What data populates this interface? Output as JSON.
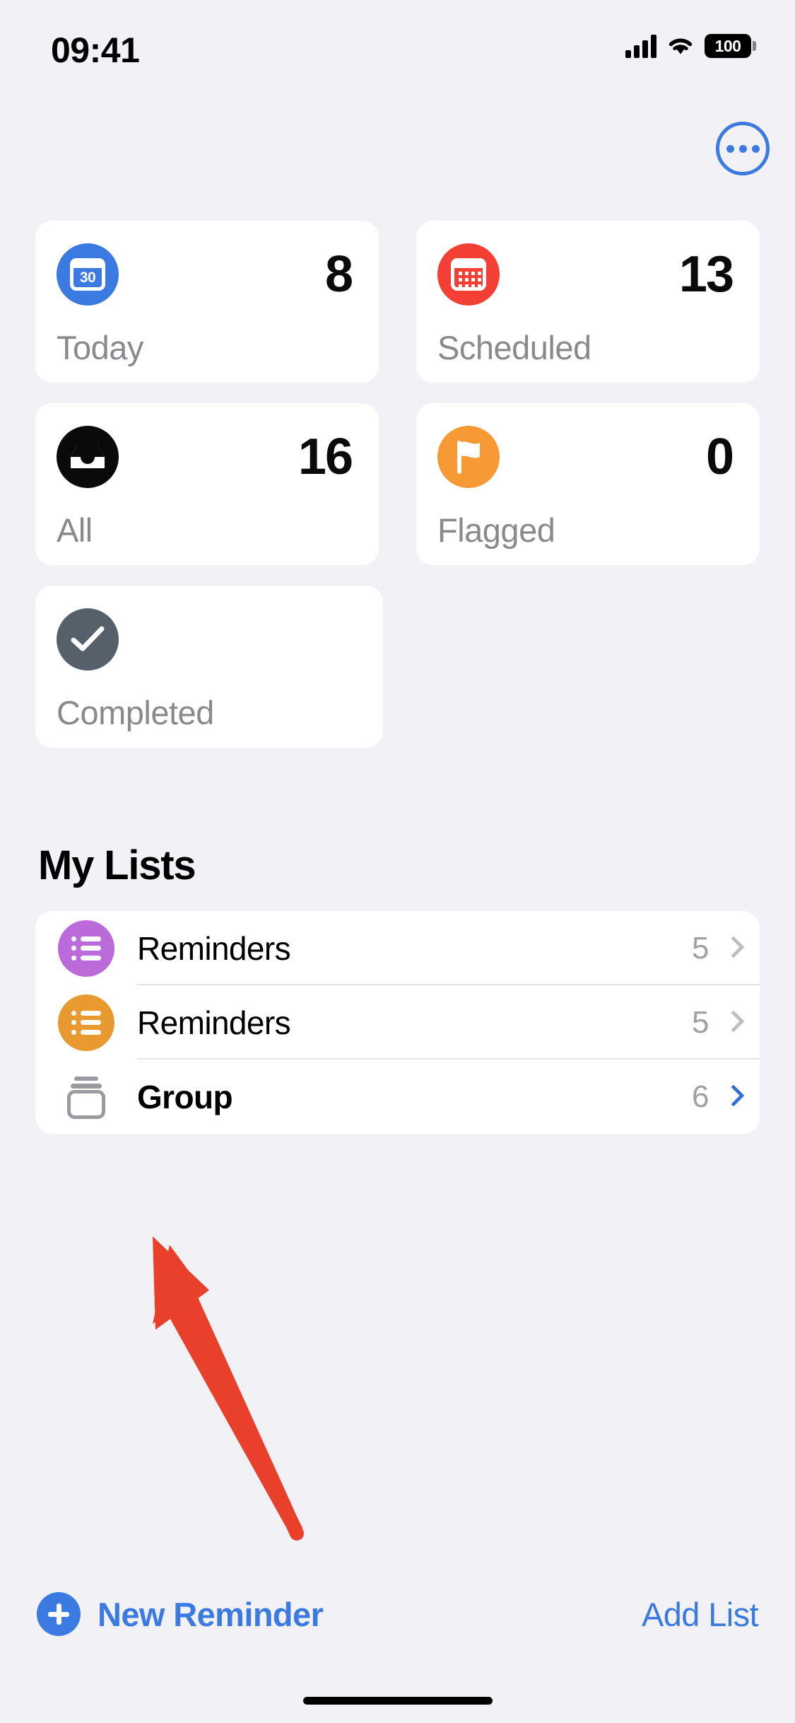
{
  "status_bar": {
    "time": "09:41",
    "cellular_icon": "cellular-bars-icon",
    "wifi_icon": "wifi-icon",
    "battery_level": "100"
  },
  "nav": {
    "more_button_icon": "more-ellipsis-icon",
    "more_button_label": "More"
  },
  "smart_lists": [
    {
      "id": "today",
      "label": "Today",
      "count": "8",
      "icon": "calendar-day-icon",
      "icon_day": "30",
      "color": "#3b7ae0"
    },
    {
      "id": "scheduled",
      "label": "Scheduled",
      "count": "13",
      "icon": "calendar-grid-icon",
      "color": "#f43f34"
    },
    {
      "id": "all",
      "label": "All",
      "count": "16",
      "icon": "inbox-tray-icon",
      "color": "#0a0a0a"
    },
    {
      "id": "flagged",
      "label": "Flagged",
      "count": "0",
      "icon": "flag-icon",
      "color": "#f79a36"
    },
    {
      "id": "completed",
      "label": "Completed",
      "count": "",
      "icon": "checkmark-icon",
      "color": "#56606a"
    }
  ],
  "my_lists": {
    "heading": "My Lists",
    "rows": [
      {
        "name": "Reminders",
        "count": "5",
        "icon": "bulleted-list-icon",
        "color": "#bb6bd9",
        "chevron": "gray",
        "bold": false
      },
      {
        "name": "Reminders",
        "count": "5",
        "icon": "bulleted-list-icon",
        "color": "#e8992f",
        "chevron": "gray",
        "bold": false
      },
      {
        "name": "Group",
        "count": "6",
        "icon": "group-folder-icon",
        "color": "#9a9aa0",
        "chevron": "blue",
        "bold": true
      }
    ]
  },
  "toolbar": {
    "new_reminder_label": "New Reminder",
    "new_reminder_icon": "plus-circle-icon",
    "add_list_label": "Add List"
  },
  "annotation": {
    "arrow_icon": "red-arrow-pointer",
    "arrow_color": "#e8402a",
    "points_to": "Group"
  },
  "theme": {
    "background": "#f2f1f6",
    "card_background": "#ffffff",
    "accent_blue": "#3b7ae0",
    "secondary_label": "#8a8a8e",
    "count_label": "#a0a0a5"
  }
}
